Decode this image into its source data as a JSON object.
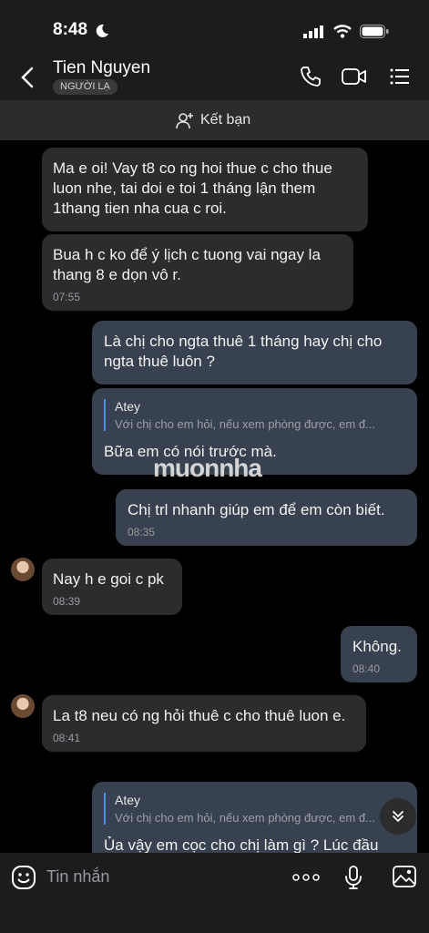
{
  "status": {
    "time": "8:48"
  },
  "header": {
    "name": "Tien Nguyen",
    "badge": "NGƯỜI LẠ",
    "add_friend": "Kết bạn"
  },
  "messages": [
    {
      "id": "m1",
      "dir": "in",
      "text": "Ma e oi! Vay t8 co ng hoi thue c cho thue luon nhe, tai doi e toi 1 tháng lận them 1thang tien nha cua c roi.",
      "time": ""
    },
    {
      "id": "m2",
      "dir": "in",
      "text": "Bua h c ko để ý lịch c tuong vai ngay la thang 8 e dọn vô r.",
      "time": "07:55"
    },
    {
      "id": "m3",
      "dir": "out",
      "text": "Là chị cho ngta thuê 1 tháng hay chị cho ngta thuê luôn ?",
      "time": ""
    },
    {
      "id": "m4",
      "dir": "out",
      "quote_name": "Atey",
      "quote_text": "Với chị cho em hỏi, nếu xem phòng được, em đ...",
      "text": "Bữa em có nói trước mà.",
      "time": ""
    },
    {
      "id": "m5",
      "dir": "out",
      "text": "Chị trl nhanh giúp em để em còn biết.",
      "time": "08:35"
    },
    {
      "id": "m6",
      "dir": "in",
      "text": "Nay h e goi c pk",
      "time": "08:39"
    },
    {
      "id": "m7",
      "dir": "out",
      "text": "Không.",
      "time": "08:40"
    },
    {
      "id": "m8",
      "dir": "in",
      "text": "La t8 neu có ng hỏi thuê c cho thuê luon e.",
      "time": "08:41"
    },
    {
      "id": "m9",
      "dir": "out",
      "quote_name": "Atey",
      "quote_text": "Với chị cho em hỏi, nếu xem phòng được, em đ...",
      "text": "Ủa vậy em cọc cho chị làm gì ? Lúc đầu",
      "time": ""
    }
  ],
  "watermark": "muonnha",
  "input": {
    "placeholder": "Tin nhắn"
  },
  "colors": {
    "incoming_bubble": "#2c2c2e",
    "outgoing_bubble": "#38414f",
    "quote_bar": "#4a90e2",
    "background": "#000000"
  },
  "icons": [
    "moon-icon",
    "signal-icon",
    "wifi-icon",
    "battery-icon",
    "back-chevron-icon",
    "phone-icon",
    "video-icon",
    "menu-list-icon",
    "add-friend-icon",
    "sticker-icon",
    "more-dots-icon",
    "mic-icon",
    "image-icon",
    "scroll-down-icon"
  ]
}
